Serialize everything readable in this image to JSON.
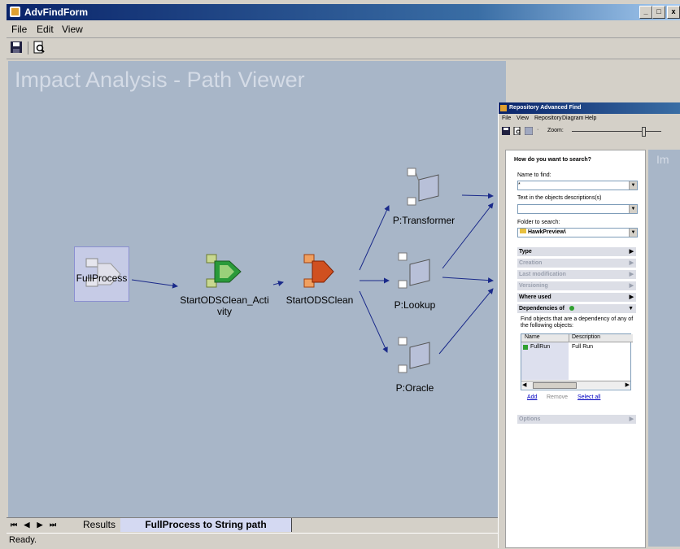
{
  "window": {
    "title": "AdvFindForm",
    "menu": [
      "File",
      "Edit",
      "View"
    ]
  },
  "canvas": {
    "title": "Impact Analysis - Path Viewer",
    "nodes": {
      "fullprocess": "FullProcess",
      "activity_line1": "StartODSClean_Acti",
      "activity_line2": "vity",
      "startodsclean": "StartODSClean",
      "transformer": "P:Transformer",
      "lookup": "P:Lookup",
      "oracle": "P:Oracle"
    }
  },
  "tabs": {
    "nav": [
      "⏮",
      "◀",
      "▶",
      "⏭"
    ],
    "results": "Results",
    "active": "FullProcess to String path"
  },
  "status": "Ready.",
  "adv_find": {
    "title": "Repository Advanced Find",
    "menu": [
      "File",
      "View",
      "Repository",
      "Diagram",
      "Help"
    ],
    "zoom_label": "Zoom:",
    "heading": "How do you want to search?",
    "name_label": "Name to find:",
    "name_value": "*",
    "desc_label": "Text in the objects descriptions(s)",
    "desc_value": "",
    "folder_label": "Folder to search:",
    "folder_value": "HawkPreview\\",
    "sections": {
      "type": "Type",
      "creation": "Creation",
      "last_mod": "Last modification",
      "versioning": "Versioning",
      "where_used": "Where used",
      "deps": "Dependencies of",
      "options": "Options"
    },
    "deps_help": "Find objects that are a dependency of any of the following objects:",
    "table_headers": [
      "Name",
      "Description"
    ],
    "table_rows": [
      {
        "name": "FullRun",
        "description": "Full Run"
      }
    ],
    "actions": {
      "add": "Add",
      "remove": "Remove",
      "select_all": "Select all"
    },
    "right_text": "Im"
  },
  "colors": {
    "canvas_bg": "#a8b6c8",
    "title_bar": "#0a246a",
    "active_tab": "#d4d9f2",
    "arrow": "#1a2a8a"
  }
}
